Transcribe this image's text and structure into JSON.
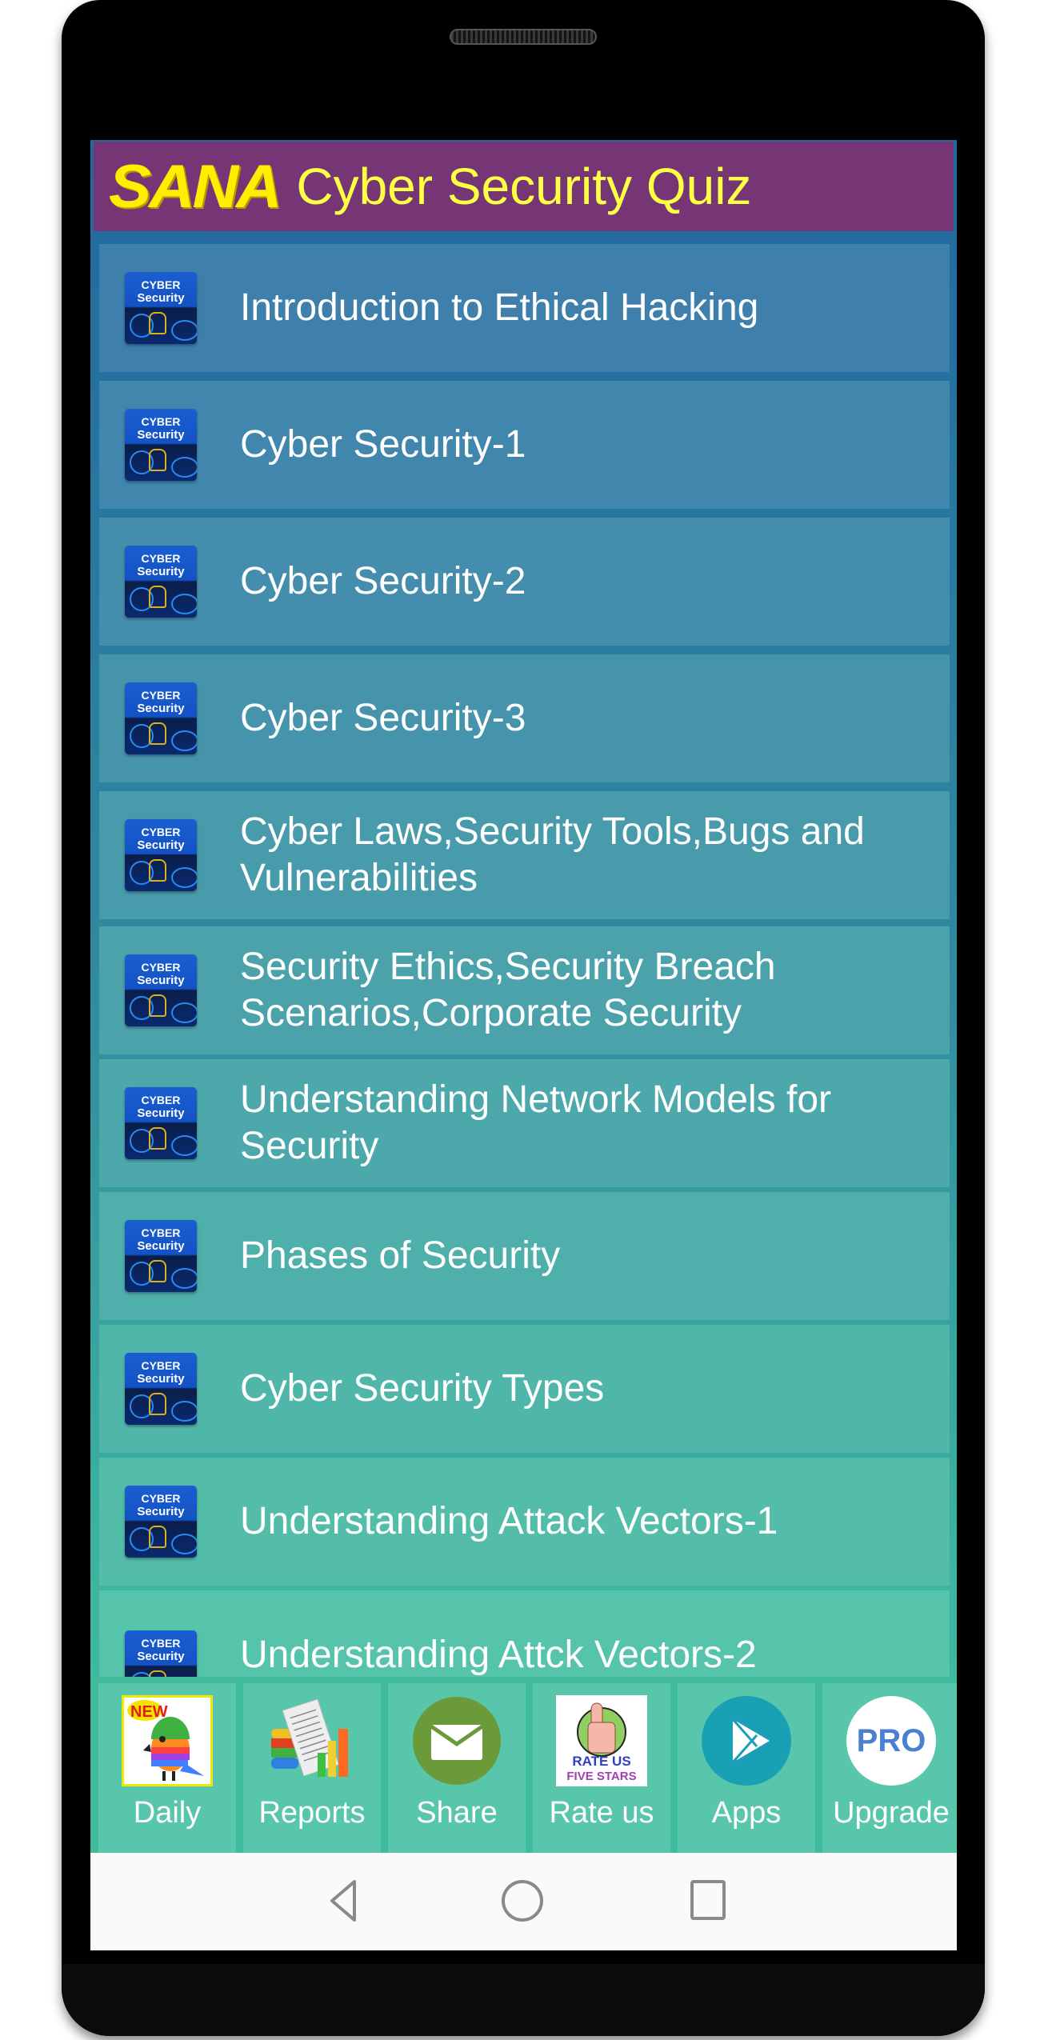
{
  "header": {
    "brand": "SANA",
    "title": "Cyber Security Quiz"
  },
  "list_icon": {
    "line1": "CYBER",
    "line2": "Security"
  },
  "topics": [
    {
      "label": "Introduction to Ethical Hacking"
    },
    {
      "label": "Cyber Security-1"
    },
    {
      "label": "Cyber Security-2"
    },
    {
      "label": "Cyber Security-3"
    },
    {
      "label": "Cyber Laws,Security Tools,Bugs and Vulnerabilities"
    },
    {
      "label": "Security Ethics,Security Breach Scenarios,Corporate Security"
    },
    {
      "label": "Understanding Network Models for Security"
    },
    {
      "label": "Phases of Security"
    },
    {
      "label": "Cyber Security Types"
    },
    {
      "label": "Understanding Attack Vectors-1"
    },
    {
      "label": "Understanding Attck Vectors-2"
    }
  ],
  "toolbar": {
    "items": [
      {
        "label": "Daily",
        "icon": "new-bird-icon",
        "badge": "NEW"
      },
      {
        "label": "Reports",
        "icon": "reports-chart-icon"
      },
      {
        "label": "Share",
        "icon": "mail-icon"
      },
      {
        "label": "Rate us",
        "icon": "rate-us-thumbs-up-icon",
        "line1": "RATE US",
        "line2": "FIVE STARS"
      },
      {
        "label": "Apps",
        "icon": "play-store-icon"
      },
      {
        "label": "Upgrade",
        "icon": "pro-icon",
        "badge": "PRO"
      }
    ]
  },
  "colors": {
    "header_bg": "#763676",
    "title_yellow": "#ffff44",
    "top_bg": "#2167a0",
    "bottom_bg": "#45c1a2",
    "share_green": "#6a9a3a",
    "apps_teal": "#1aa0b4",
    "pro_blue": "#4a80d0"
  }
}
